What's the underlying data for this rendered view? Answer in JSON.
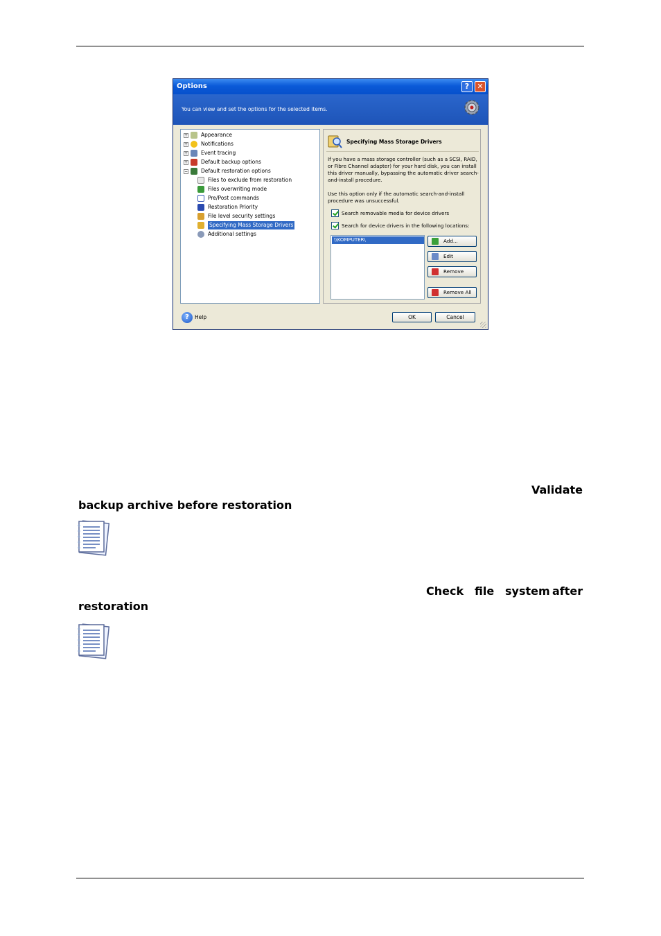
{
  "dialog": {
    "title": "Options",
    "help_button": "?",
    "close_button": "✕",
    "description": "You can view and set the options for the selected items.",
    "tree": [
      {
        "label": "Appearance",
        "level": 0,
        "expander": "+"
      },
      {
        "label": "Notifications",
        "level": 0,
        "expander": "+"
      },
      {
        "label": "Event tracing",
        "level": 0,
        "expander": "+"
      },
      {
        "label": "Default backup options",
        "level": 0,
        "expander": "+"
      },
      {
        "label": "Default restoration options",
        "level": 0,
        "expander": "−"
      },
      {
        "label": "Files to exclude from restoration",
        "level": 1
      },
      {
        "label": "Files overwriting mode",
        "level": 1
      },
      {
        "label": "Pre/Post commands",
        "level": 1
      },
      {
        "label": "Restoration Priority",
        "level": 1
      },
      {
        "label": "File level security settings",
        "level": 1
      },
      {
        "label": "Specifying Mass Storage Drivers",
        "level": 1,
        "selected": true
      },
      {
        "label": "Additional settings",
        "level": 1
      }
    ],
    "panel": {
      "title": "Specifying Mass Storage Drivers",
      "paragraph1": "If you have a mass storage controller (such as a SCSI, RAID, or Fibre Channel adapter) for your hard disk, you can install this driver manually, bypassing the automatic driver search-and-install procedure.",
      "paragraph2": "Use this option only if the automatic search-and-install procedure was unsuccessful.",
      "checkbox1": "Search removable media for device drivers",
      "checkbox2": "Search for device drivers in the following locations:",
      "locations": [
        "\\\\KOMPUTER\\"
      ],
      "add_button": "Add...",
      "edit_button": "Edit",
      "remove_button": "Remove",
      "remove_all_button": "Remove All"
    },
    "help_label": "Help",
    "ok_button": "OK",
    "cancel_button": "Cancel"
  },
  "body": {
    "text1_line1": "Validate",
    "text1_line2": "backup archive before restoration",
    "text2_line1_a": "Check",
    "text2_line1_b": "file",
    "text2_line1_c": "system",
    "text2_line1_d": "after",
    "text2_line2": "restoration"
  }
}
